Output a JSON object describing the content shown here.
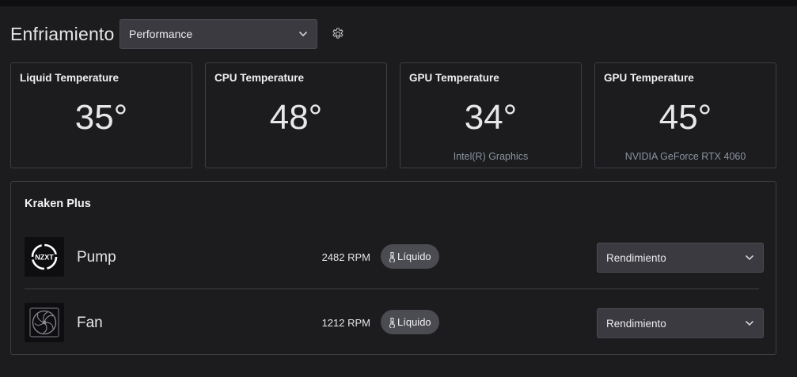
{
  "header": {
    "title": "Enfriamiento",
    "profile_select": "Performance"
  },
  "cards": [
    {
      "title": "Liquid Temperature",
      "value": "35°",
      "subtitle": ""
    },
    {
      "title": "CPU Temperature",
      "value": "48°",
      "subtitle": ""
    },
    {
      "title": "GPU Temperature",
      "value": "34°",
      "subtitle": "Intel(R) Graphics"
    },
    {
      "title": "GPU Temperature",
      "value": "45°",
      "subtitle": "NVIDIA GeForce RTX 4060"
    }
  ],
  "device": {
    "name": "Kraken Plus",
    "rows": [
      {
        "name": "Pump",
        "rpm": "2482 RPM",
        "pill": "Líquido",
        "mode": "Rendimiento",
        "icon": "nzxt-logo-icon"
      },
      {
        "name": "Fan",
        "rpm": "1212 RPM",
        "pill": "Líquido",
        "mode": "Rendimiento",
        "icon": "fan-icon"
      }
    ]
  },
  "colors": {
    "background": "#1c1c1f",
    "card_border": "#3d3d44",
    "select_bg": "#3a3a40",
    "pill_bg": "#4b4b52",
    "subtitle": "#8a93a0"
  }
}
